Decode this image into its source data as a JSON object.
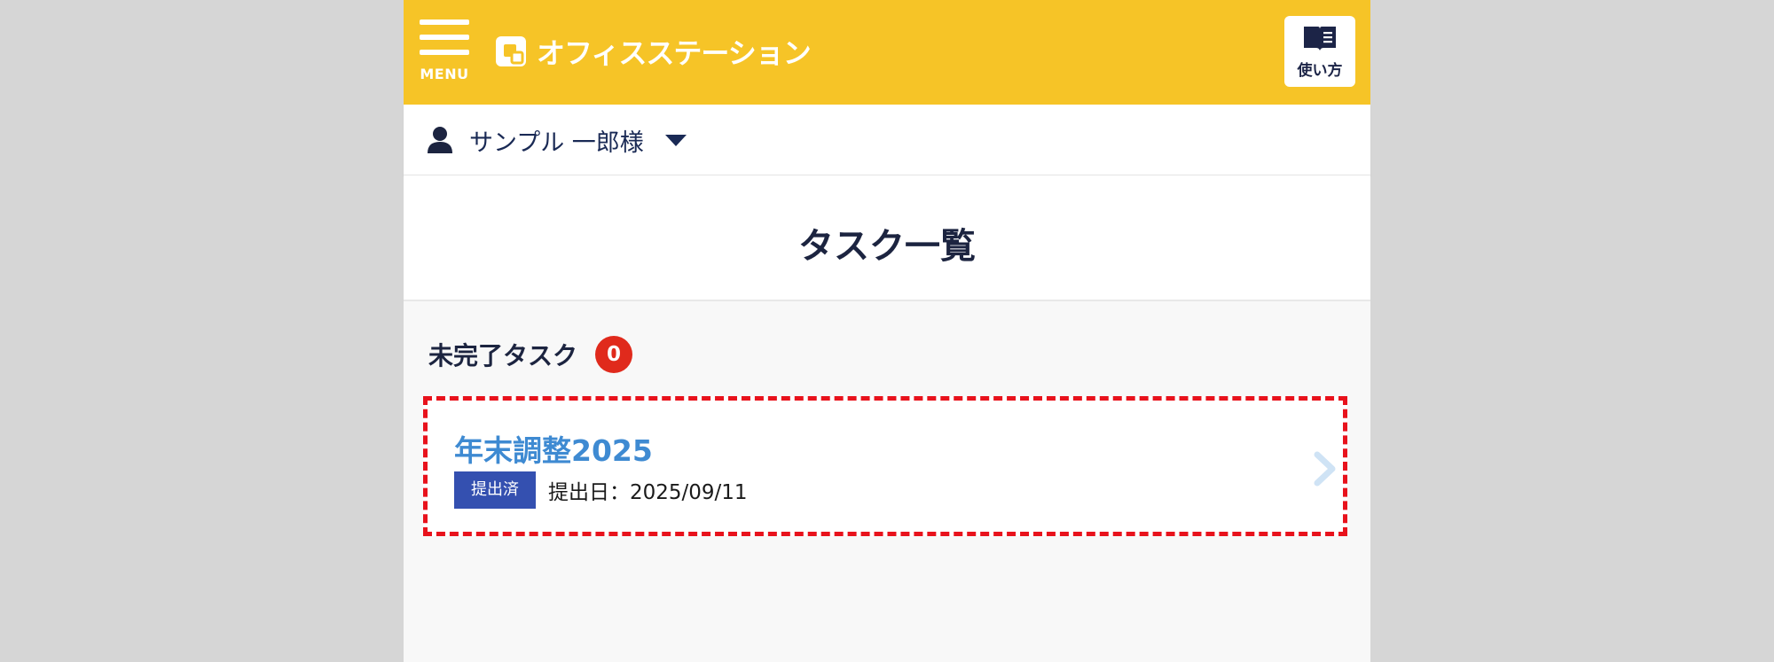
{
  "header": {
    "menu_label": "MENU",
    "app_name": "オフィスステーション",
    "help_label": "使い方",
    "background_color": "#f6c427"
  },
  "user": {
    "name": "サンプル 一郎様"
  },
  "page": {
    "title": "タスク一覧"
  },
  "section": {
    "title": "未完了タスク",
    "count": "0",
    "badge_color": "#e02a1c"
  },
  "tasks": [
    {
      "name": "年末調整2025",
      "status": "提出済",
      "submit_date": "提出日：2025/09/11",
      "name_color": "#3e8ad2",
      "status_color": "#3450b0"
    }
  ],
  "icons": {
    "menu": "hamburger-icon",
    "logo": "office-station-logo",
    "help": "book-icon",
    "user": "person-icon",
    "dropdown": "caret-down-icon",
    "open": "chevron-right-icon"
  }
}
